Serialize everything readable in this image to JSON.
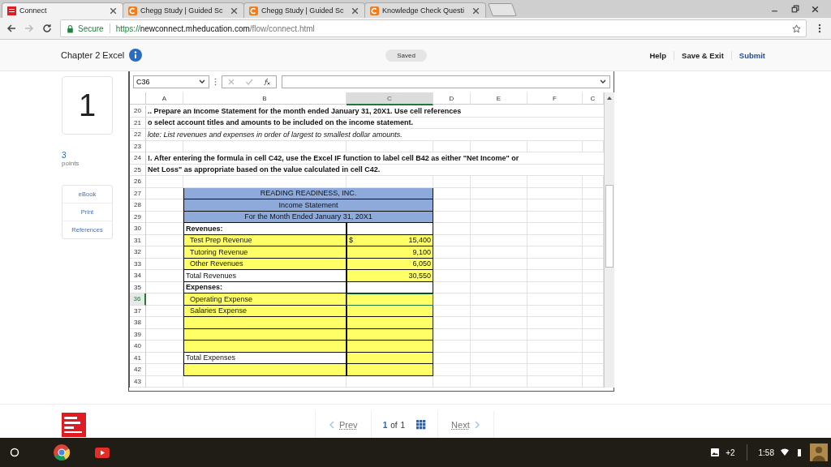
{
  "browser": {
    "tabs": [
      {
        "title": "Connect",
        "selected": true
      },
      {
        "title": "Chegg Study | Guided Sc",
        "selected": false
      },
      {
        "title": "Chegg Study | Guided Sc",
        "selected": false
      },
      {
        "title": "Knowledge Check Questi",
        "selected": false
      }
    ],
    "secure_label": "Secure",
    "url_scheme": "https://",
    "url_host": "newconnect.mheducation.com",
    "url_path": "/flow/connect.html"
  },
  "header": {
    "title": "Chapter 2 Excel",
    "status": "Saved",
    "actions": [
      "Help",
      "Save & Exit",
      "Submit"
    ]
  },
  "question": {
    "number": "1",
    "points": "3",
    "points_label": "points",
    "links": [
      "eBook",
      "Print",
      "References"
    ]
  },
  "sheet": {
    "name_box": "C36",
    "columns": [
      {
        "label": "A",
        "selected": false
      },
      {
        "label": "B",
        "selected": false
      },
      {
        "label": "C",
        "selected": true
      },
      {
        "label": "D",
        "selected": false
      },
      {
        "label": "E",
        "selected": false
      },
      {
        "label": "F",
        "selected": false
      },
      {
        "label": "C",
        "selected": false
      }
    ],
    "rows": [
      {
        "num": "20",
        "kind": "instruction",
        "text": ".. Prepare an Income Statement for the month ended January 31, 20X1.  Use cell references",
        "selected": false
      },
      {
        "num": "21",
        "kind": "instruction",
        "text": "o select account titles and amounts to be included on the income statement.",
        "selected": false
      },
      {
        "num": "22",
        "kind": "remark",
        "text": "lote:  List revenues and expenses in order of largest to smallest dollar amounts.",
        "selected": false
      },
      {
        "num": "23",
        "kind": "blank",
        "selected": false
      },
      {
        "num": "24",
        "kind": "instruction",
        "text": "!. After entering the formula in cell C42, use the Excel IF function to label cell B42 as either \"Net Income\" or",
        "selected": false
      },
      {
        "num": "25",
        "kind": "instruction",
        "text": "Net Loss\" as appropriate based on the value calculated in cell C42.",
        "selected": false
      },
      {
        "num": "26",
        "kind": "blank",
        "selected": false
      },
      {
        "num": "27",
        "kind": "title",
        "text": "READING READINESS, INC.",
        "selected": false
      },
      {
        "num": "28",
        "kind": "title",
        "text": "Income Statement",
        "selected": false
      },
      {
        "num": "29",
        "kind": "title",
        "text": "For the Month Ended January 31, 20X1",
        "selected": false
      },
      {
        "num": "30",
        "kind": "line",
        "b": "Revenues:",
        "bold": true,
        "indent": false,
        "b_highlighted": false,
        "c_highlighted": false,
        "c_selected": false,
        "selected": false
      },
      {
        "num": "31",
        "kind": "line",
        "b": "Test Prep Revenue",
        "bold": false,
        "indent": true,
        "b_highlighted": true,
        "c_highlighted": true,
        "c_prefix": "$",
        "c": "15,400",
        "c_selected": false,
        "selected": false
      },
      {
        "num": "32",
        "kind": "line",
        "b": "Tutoring Revenue",
        "bold": false,
        "indent": true,
        "b_highlighted": true,
        "c_highlighted": true,
        "c": "9,100",
        "c_selected": false,
        "selected": false
      },
      {
        "num": "33",
        "kind": "line",
        "b": "Other Revenues",
        "bold": false,
        "indent": true,
        "b_highlighted": true,
        "c_highlighted": true,
        "c": "6,050",
        "c_selected": false,
        "selected": false
      },
      {
        "num": "34",
        "kind": "line",
        "b": "Total Revenues",
        "bold": false,
        "indent": false,
        "b_highlighted": false,
        "c_highlighted": true,
        "c": "30,550",
        "c_selected": false,
        "selected": false
      },
      {
        "num": "35",
        "kind": "line",
        "b": "Expenses:",
        "bold": true,
        "indent": false,
        "b_highlighted": false,
        "c_highlighted": false,
        "c_selected": false,
        "selected": false
      },
      {
        "num": "36",
        "kind": "line",
        "b": "Operating Expense",
        "bold": false,
        "indent": true,
        "b_highlighted": true,
        "c_highlighted": true,
        "c_selected": true,
        "selected": true
      },
      {
        "num": "37",
        "kind": "line",
        "b": "Salaries Expense",
        "bold": false,
        "indent": true,
        "b_highlighted": true,
        "c_highlighted": true,
        "c_selected": false,
        "selected": false
      },
      {
        "num": "38",
        "kind": "line",
        "b_highlighted": true,
        "c_highlighted": true,
        "c_selected": false,
        "selected": false
      },
      {
        "num": "39",
        "kind": "line",
        "b_highlighted": true,
        "c_highlighted": true,
        "c_selected": false,
        "selected": false
      },
      {
        "num": "40",
        "kind": "line",
        "b_highlighted": true,
        "c_highlighted": true,
        "c_selected": false,
        "selected": false
      },
      {
        "num": "41",
        "kind": "line",
        "b": "Total Expenses",
        "bold": false,
        "indent": false,
        "b_highlighted": false,
        "c_highlighted": true,
        "c_selected": false,
        "selected": false
      },
      {
        "num": "42",
        "kind": "line",
        "b_highlighted": true,
        "c_highlighted": true,
        "c_selected": false,
        "selected": false
      },
      {
        "num": "43",
        "kind": "blank",
        "selected": false
      }
    ]
  },
  "pager": {
    "prev": "Prev",
    "current": "1",
    "of": "of",
    "total": "1",
    "next": "Next"
  },
  "taskbar": {
    "notifications": "+2",
    "time": "1:58"
  }
}
